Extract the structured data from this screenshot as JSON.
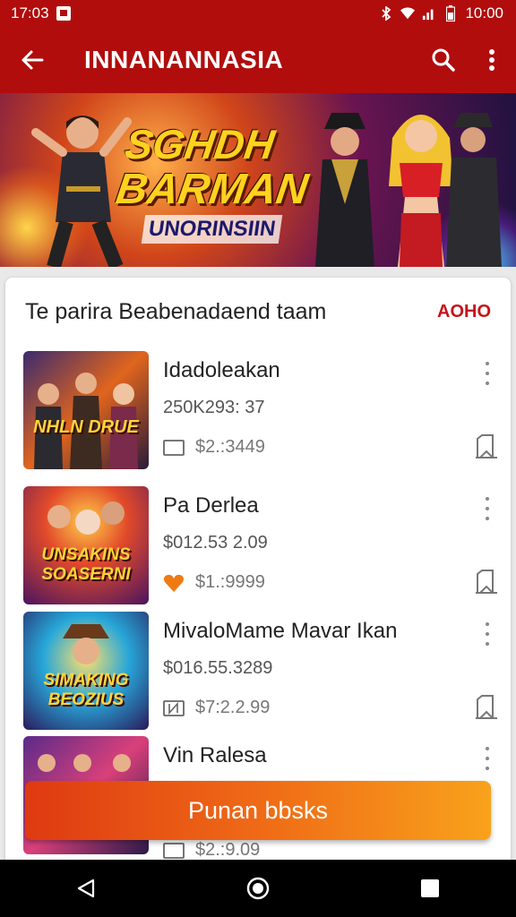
{
  "status_bar": {
    "time_left": "17:03",
    "time_right": "10:00"
  },
  "app_bar": {
    "title": "INNANANNASIA"
  },
  "banner": {
    "line1": "SGHDH",
    "line2": "BARMAN",
    "subtitle": "UNORINSIIN"
  },
  "section": {
    "title": "Te parira Beabenadaend taam",
    "action_label": "AOHO"
  },
  "items": [
    {
      "name": "Idadoleakan",
      "meta": "250K293: 37",
      "price": "$2.:3449",
      "badge_icon": "tag-icon",
      "thumb_caption": "NHLN DRUE"
    },
    {
      "name": "Pa Derlea",
      "meta": "$012.53 2.09",
      "price": "$1.:9999",
      "badge_icon": "heart-icon",
      "thumb_caption": "UNSAKINS SOASERNI"
    },
    {
      "name": "MivaloMame Mavar Ikan",
      "meta": "$016.55.3289",
      "price": "$7:2.2.99",
      "badge_icon": "tag-icon",
      "thumb_caption": "SIMAKING BEOZIUS"
    },
    {
      "name": "Vin Ralesa",
      "meta": "",
      "price": "$2.:9.09",
      "badge_icon": "tag-icon",
      "thumb_caption": ""
    }
  ],
  "cta": {
    "label": "Punan bbsks"
  },
  "colors": {
    "primary": "#b10d0d",
    "accent": "#c8141c",
    "cta_start": "#de3a12",
    "cta_end": "#f8a21b"
  }
}
